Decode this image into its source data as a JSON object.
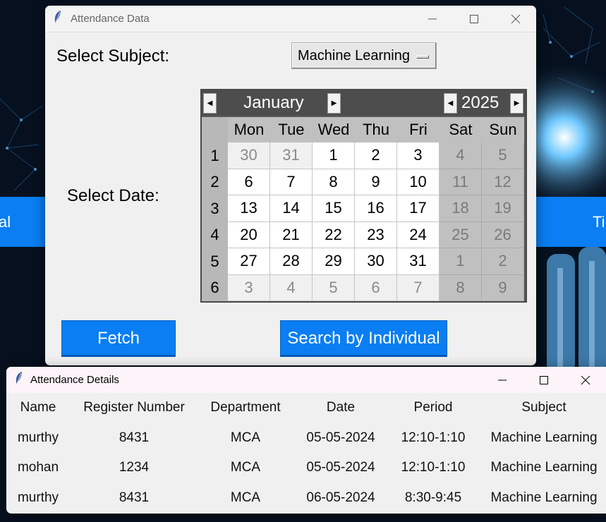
{
  "background": {
    "left_band_text": "al",
    "right_band_text": "Ti"
  },
  "main_window": {
    "title": "Attendance Data",
    "subject_label": "Select Subject:",
    "subject_value": "Machine Learning",
    "date_label": "Select Date:",
    "calendar": {
      "month": "January",
      "year": "2025",
      "day_names": [
        "Mon",
        "Tue",
        "Wed",
        "Thu",
        "Fri",
        "Sat",
        "Sun"
      ],
      "weeks": [
        {
          "num": "1",
          "days": [
            "30",
            "31",
            "1",
            "2",
            "3",
            "4",
            "5"
          ]
        },
        {
          "num": "2",
          "days": [
            "6",
            "7",
            "8",
            "9",
            "10",
            "11",
            "12"
          ]
        },
        {
          "num": "3",
          "days": [
            "13",
            "14",
            "15",
            "16",
            "17",
            "18",
            "19"
          ]
        },
        {
          "num": "4",
          "days": [
            "20",
            "21",
            "22",
            "23",
            "24",
            "25",
            "26"
          ]
        },
        {
          "num": "5",
          "days": [
            "27",
            "28",
            "29",
            "30",
            "31",
            "1",
            "2"
          ]
        },
        {
          "num": "6",
          "days": [
            "3",
            "4",
            "5",
            "6",
            "7",
            "8",
            "9"
          ]
        }
      ]
    },
    "fetch_label": "Fetch",
    "search_label": "Search by Individual"
  },
  "details_window": {
    "title": "Attendance Details",
    "columns": [
      "Name",
      "Register Number",
      "Department",
      "Date",
      "Period",
      "Subject"
    ],
    "rows": [
      [
        "murthy",
        "8431",
        "MCA",
        "05-05-2024",
        "12:10-1:10",
        "Machine Learning"
      ],
      [
        "mohan",
        "1234",
        "MCA",
        "05-05-2024",
        "12:10-1:10",
        "Machine Learning"
      ],
      [
        "murthy",
        "8431",
        "MCA",
        "06-05-2024",
        "8:30-9:45",
        "Machine Learning"
      ]
    ]
  },
  "colors": {
    "accent": "#0a7ef2",
    "calendar_header": "#4d4d4d",
    "weekend_bg": "#c0c0c0"
  }
}
